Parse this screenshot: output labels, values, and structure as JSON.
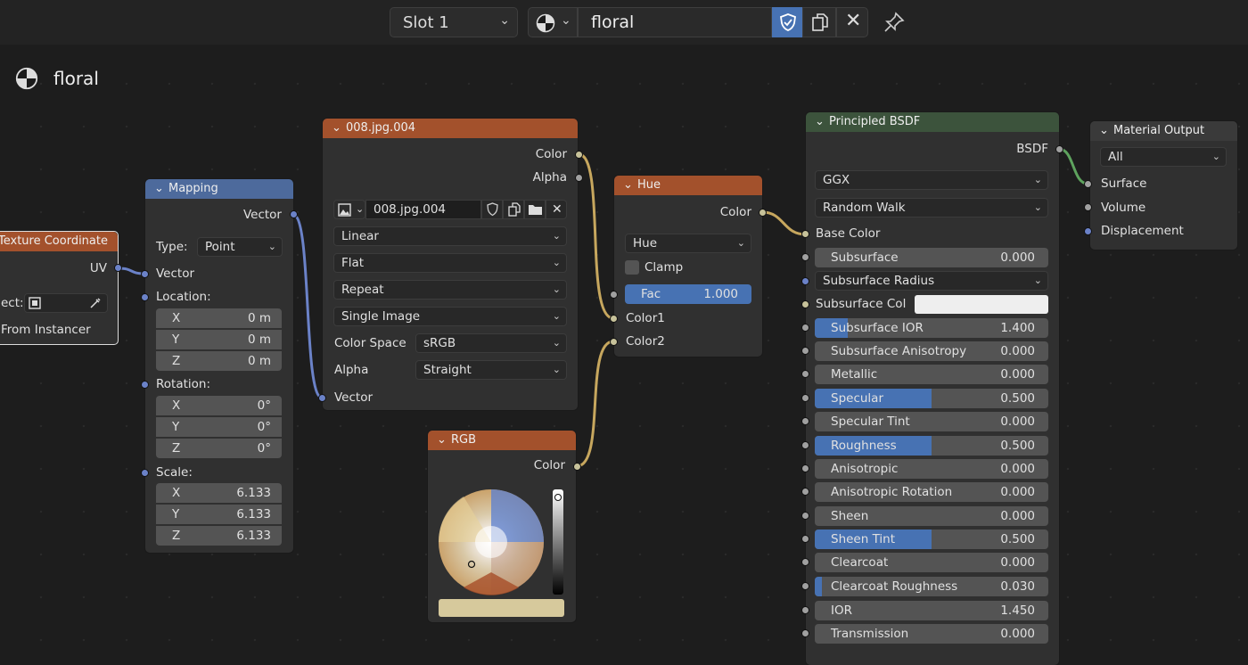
{
  "header": {
    "slot": "Slot 1",
    "material_name": "floral"
  },
  "breadcrumb": {
    "material": "floral"
  },
  "texcoord": {
    "title": "Texture Coordinate",
    "uv": "UV",
    "object_label": "ect:",
    "from_instancer": "From Instancer"
  },
  "mapping": {
    "title": "Mapping",
    "vector_out": "Vector",
    "type_label": "Type:",
    "type_value": "Point",
    "vector_in": "Vector",
    "location_label": "Location:",
    "location": [
      {
        "axis": "X",
        "value": "0 m"
      },
      {
        "axis": "Y",
        "value": "0 m"
      },
      {
        "axis": "Z",
        "value": "0 m"
      }
    ],
    "rotation_label": "Rotation:",
    "rotation": [
      {
        "axis": "X",
        "value": "0°"
      },
      {
        "axis": "Y",
        "value": "0°"
      },
      {
        "axis": "Z",
        "value": "0°"
      }
    ],
    "scale_label": "Scale:",
    "scale": [
      {
        "axis": "X",
        "value": "6.133"
      },
      {
        "axis": "Y",
        "value": "6.133"
      },
      {
        "axis": "Z",
        "value": "6.133"
      }
    ]
  },
  "image": {
    "title": "008.jpg.004",
    "color_out": "Color",
    "alpha_out": "Alpha",
    "image_name": "008.jpg.004",
    "interpolation": "Linear",
    "projection": "Flat",
    "extension": "Repeat",
    "source": "Single Image",
    "color_space_label": "Color Space",
    "color_space": "sRGB",
    "alpha_label": "Alpha",
    "alpha_mode": "Straight",
    "vector_in": "Vector"
  },
  "hue": {
    "title": "Hue",
    "color_out": "Color",
    "mode": "Hue",
    "clamp": "Clamp",
    "fac_label": "Fac",
    "fac_value": "1.000",
    "color1": "Color1",
    "color2": "Color2"
  },
  "rgb": {
    "title": "RGB",
    "color_out": "Color",
    "swatch": "#d6c99c"
  },
  "bsdf": {
    "title": "Principled BSDF",
    "bsdf_out": "BSDF",
    "distribution": "GGX",
    "subsurface_method": "Random Walk",
    "base_color": "Base Color",
    "subsurface_radius": "Subsurface Radius",
    "subsurface_col": "Subsurface Col",
    "fields": [
      {
        "label": "Subsurface",
        "value": "0.000",
        "fill": 0
      },
      {
        "label": "Subsurface IOR",
        "value": "1.400",
        "fill": 0.14
      },
      {
        "label": "Subsurface Anisotropy",
        "value": "0.000",
        "fill": 0
      },
      {
        "label": "Metallic",
        "value": "0.000",
        "fill": 0
      },
      {
        "label": "Specular",
        "value": "0.500",
        "fill": 0.5
      },
      {
        "label": "Specular Tint",
        "value": "0.000",
        "fill": 0
      },
      {
        "label": "Roughness",
        "value": "0.500",
        "fill": 0.5
      },
      {
        "label": "Anisotropic",
        "value": "0.000",
        "fill": 0
      },
      {
        "label": "Anisotropic Rotation",
        "value": "0.000",
        "fill": 0
      },
      {
        "label": "Sheen",
        "value": "0.000",
        "fill": 0
      },
      {
        "label": "Sheen Tint",
        "value": "0.500",
        "fill": 0.5
      },
      {
        "label": "Clearcoat",
        "value": "0.000",
        "fill": 0
      },
      {
        "label": "Clearcoat Roughness",
        "value": "0.030",
        "fill": 0.03
      },
      {
        "label": "IOR",
        "value": "1.450",
        "fill": 0
      },
      {
        "label": "Transmission",
        "value": "0.000",
        "fill": 0
      }
    ]
  },
  "output": {
    "title": "Material Output",
    "target": "All",
    "surface": "Surface",
    "volume": "Volume",
    "displacement": "Displacement"
  },
  "colors": {
    "texture_header": "#a3512c",
    "vector_header": "#4d6a9c",
    "shader_header": "#3c533c",
    "output_header": "#3a3a3a",
    "accent": "#4772b3"
  }
}
